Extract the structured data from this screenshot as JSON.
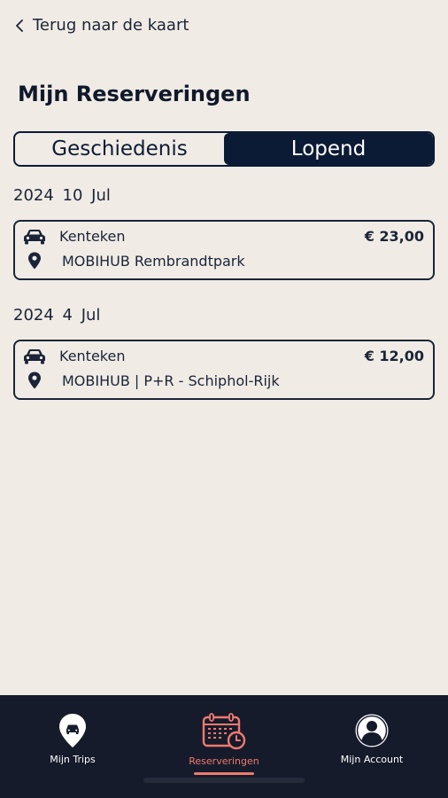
{
  "header": {
    "back_label": "Terug naar de kaart"
  },
  "page": {
    "title": "Mijn Reserveringen"
  },
  "segment": {
    "options": [
      {
        "label": "Geschiedenis",
        "active": false
      },
      {
        "label": "Lopend",
        "active": true
      }
    ]
  },
  "reservations": [
    {
      "date": "2024  10 Jul",
      "plate_label": "Kenteken",
      "location": "MOBIHUB Rembrandtpark",
      "price": "€ 23,00"
    },
    {
      "date": "2024  4 Jul",
      "plate_label": "Kenteken",
      "location": "MOBIHUB | P+R - Schiphol-Rijk",
      "price": "€ 12,00"
    }
  ],
  "tabbar": {
    "items": [
      {
        "label": "Mijn Trips",
        "icon": "car-pin-icon",
        "active": false
      },
      {
        "label": "Reserveringen",
        "icon": "calendar-clock-icon",
        "active": true
      },
      {
        "label": "Mijn Account",
        "icon": "user-icon",
        "active": false
      }
    ]
  },
  "colors": {
    "background": "#f0ece5",
    "navy": "#0c1b35",
    "tabbar": "#161b2b",
    "accent": "#ee7a6c"
  }
}
